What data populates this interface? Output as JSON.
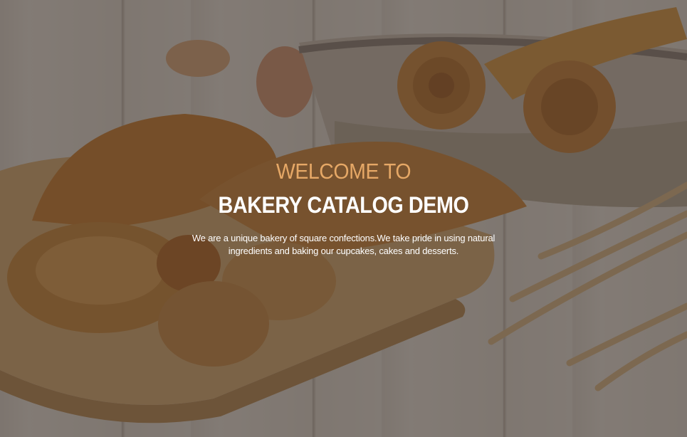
{
  "hero": {
    "welcome": "WELCOME TO",
    "title": "BAKERY CATALOG DEMO",
    "description": "We are a unique bakery of square confections.We take pride in using natural ingredients and baking our cupcakes, cakes and desserts."
  },
  "colors": {
    "accent": "#e6a866",
    "title": "#ffffff",
    "overlay": "#2a1e19"
  }
}
